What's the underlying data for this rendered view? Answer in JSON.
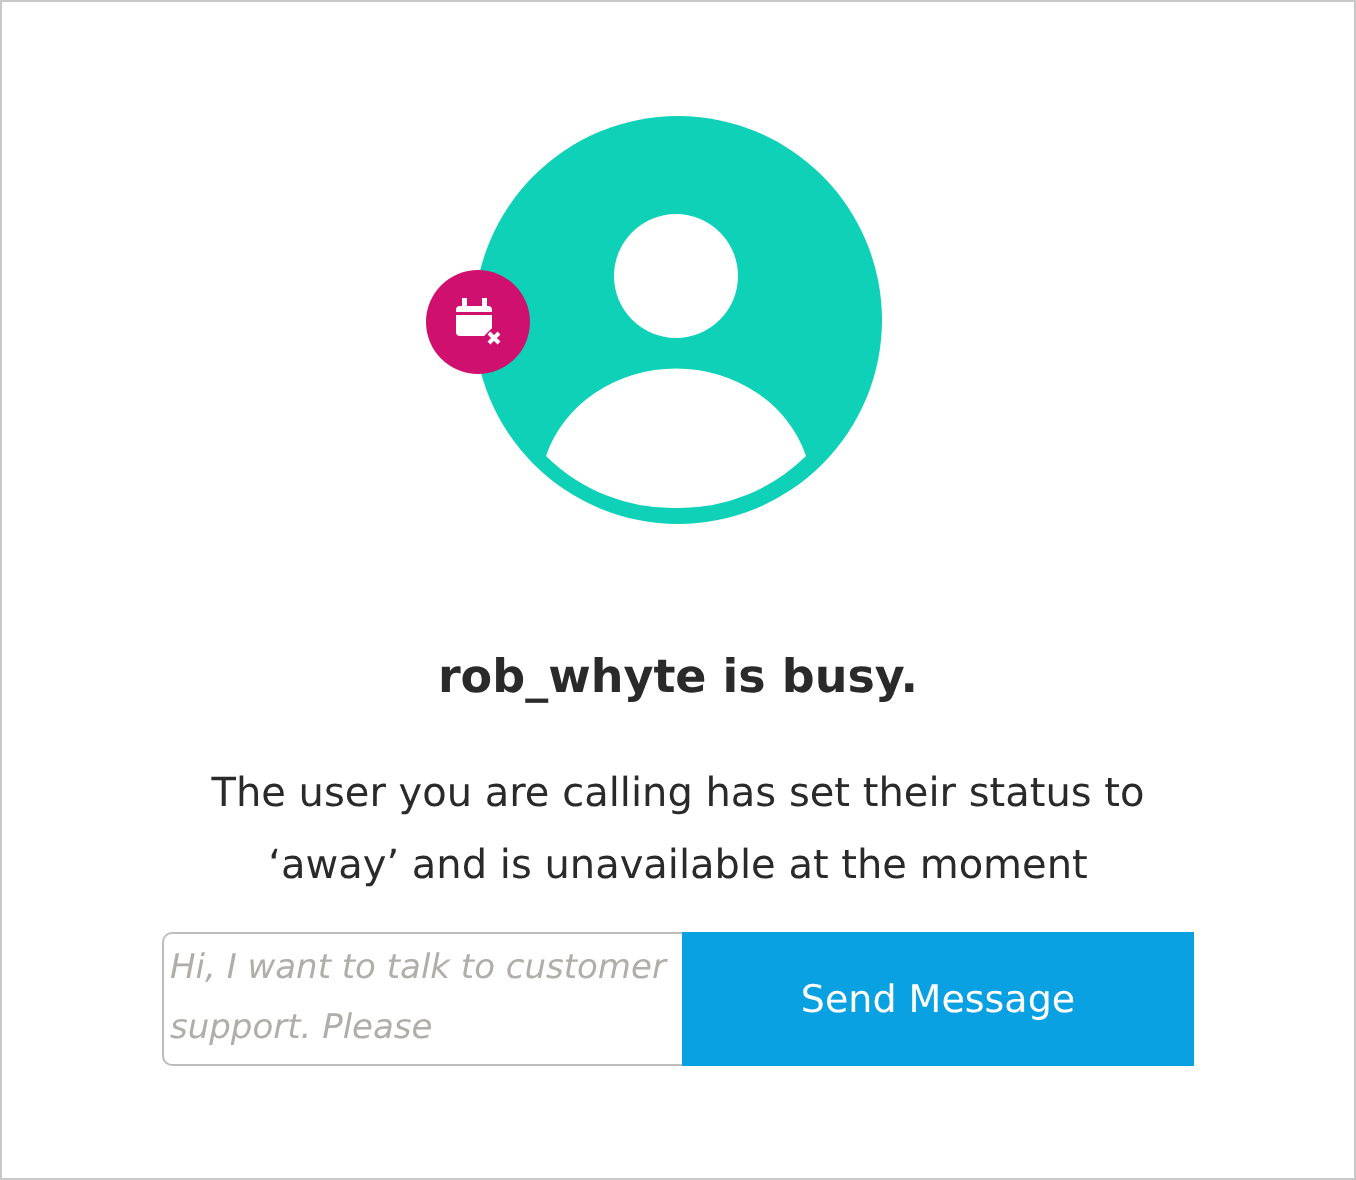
{
  "title": "rob_whyte is busy.",
  "message": "The user you are calling has set their status to ‘away’ and is unavailable at the moment",
  "message_field": {
    "placeholder": "Hi, I want to talk to customer support. Please"
  },
  "send_button": "Send Message"
}
